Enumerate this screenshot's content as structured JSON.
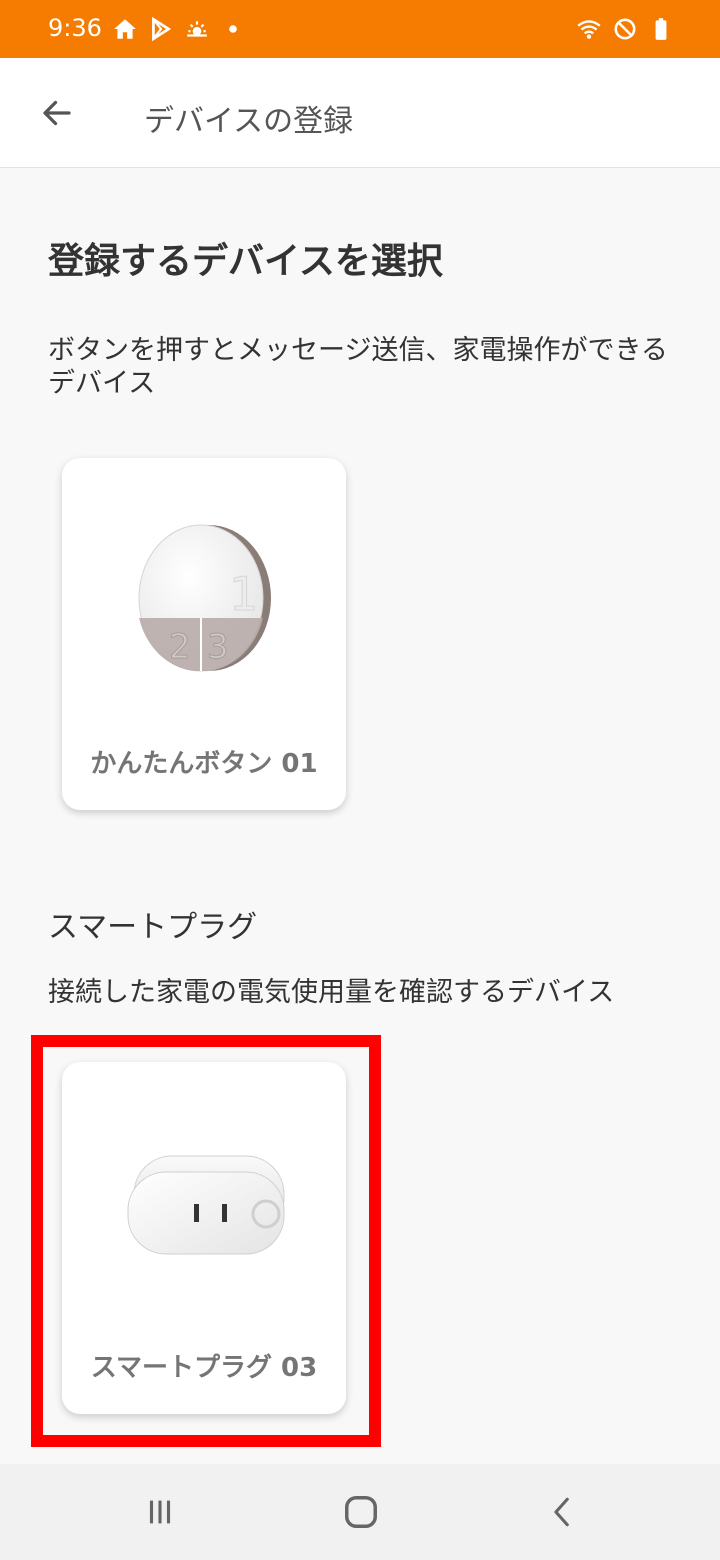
{
  "status_bar": {
    "time": "9:36",
    "left_icons": [
      "home-icon",
      "play-store-icon",
      "weather-icon",
      "dot-icon"
    ],
    "right_icons": [
      "wifi-icon",
      "do-not-disturb-icon",
      "battery-icon"
    ],
    "color": "#f57c00"
  },
  "app_bar": {
    "title": "デバイスの登録",
    "back_icon": "arrow-left-icon"
  },
  "main": {
    "heading": "登録するデバイスを選択",
    "sections": [
      {
        "title": "",
        "description": "ボタンを押すとメッセージ送信、家電操作ができるデバイス",
        "devices": [
          {
            "label": "かんたんボタン 01",
            "image": "round-button-device-image"
          }
        ]
      },
      {
        "title": "スマートプラグ",
        "description": "接続した家電の電気使用量を確認するデバイス",
        "devices": [
          {
            "label": "スマートプラグ 03",
            "image": "smart-plug-device-image",
            "highlighted": true
          }
        ]
      }
    ]
  },
  "highlight_color": "#ff0000",
  "nav_bar": {
    "buttons": [
      "recents-icon",
      "home-icon",
      "back-icon"
    ]
  }
}
